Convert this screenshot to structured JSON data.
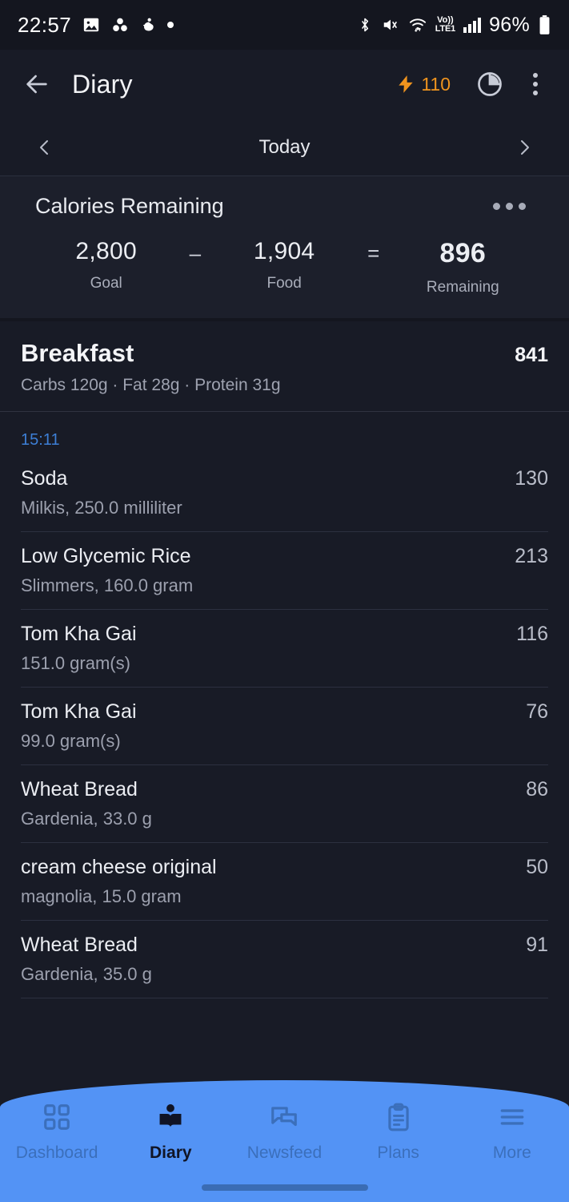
{
  "statusbar": {
    "time": "22:57",
    "battery_percent": "96%",
    "left_icons": [
      "image-icon",
      "drive-icon",
      "figure-icon",
      "dot-icon"
    ],
    "right_icons": [
      "bluetooth-icon",
      "volume-mute-icon",
      "wifi-icon",
      "volte-lte-icon",
      "signal-bars-icon",
      "battery-icon"
    ],
    "volte_top": "Vo))",
    "volte_bottom": "LTE1"
  },
  "appbar": {
    "back_icon": "back-arrow-icon",
    "title": "Diary",
    "streak_value": "110",
    "streak_icon": "lightning-bolt-icon",
    "pie_icon": "pie-chart-icon",
    "menu_icon": "overflow-menu-icon",
    "accent": "#f0941e"
  },
  "datenav": {
    "prev_icon": "chevron-left-icon",
    "label": "Today",
    "next_icon": "chevron-right-icon"
  },
  "calories": {
    "title": "Calories Remaining",
    "menu_icon": "overflow-dots-icon",
    "goal_value": "2,800",
    "goal_label": "Goal",
    "minus": "–",
    "food_value": "1,904",
    "food_label": "Food",
    "equals": "=",
    "remaining_value": "896",
    "remaining_label": "Remaining"
  },
  "meal": {
    "name": "Breakfast",
    "calories": "841",
    "macros": "Carbs 120g · Fat 28g · Protein 31g",
    "time": "15:11",
    "time_color": "#3d7fd6",
    "items": [
      {
        "name": "Soda",
        "sub": "Milkis, 250.0 milliliter",
        "calories": "130"
      },
      {
        "name": "Low Glycemic Rice",
        "sub": "Slimmers, 160.0 gram",
        "calories": "213"
      },
      {
        "name": "Tom Kha Gai",
        "sub": "151.0 gram(s)",
        "calories": "116"
      },
      {
        "name": "Tom Kha Gai",
        "sub": "99.0 gram(s)",
        "calories": "76"
      },
      {
        "name": "Wheat Bread",
        "sub": "Gardenia, 33.0 g",
        "calories": "86"
      },
      {
        "name": "cream cheese original",
        "sub": "magnolia, 15.0 gram",
        "calories": "50"
      },
      {
        "name": "Wheat Bread",
        "sub": "Gardenia, 35.0 g",
        "calories": "91"
      }
    ]
  },
  "bottomnav": {
    "background": "#5393f5",
    "items": [
      {
        "label": "Dashboard",
        "icon": "grid-icon",
        "active": false
      },
      {
        "label": "Diary",
        "icon": "book-icon",
        "active": true
      },
      {
        "label": "Newsfeed",
        "icon": "chat-icon",
        "active": false
      },
      {
        "label": "Plans",
        "icon": "clipboard-icon",
        "active": false
      },
      {
        "label": "More",
        "icon": "hamburger-icon",
        "active": false
      }
    ]
  }
}
